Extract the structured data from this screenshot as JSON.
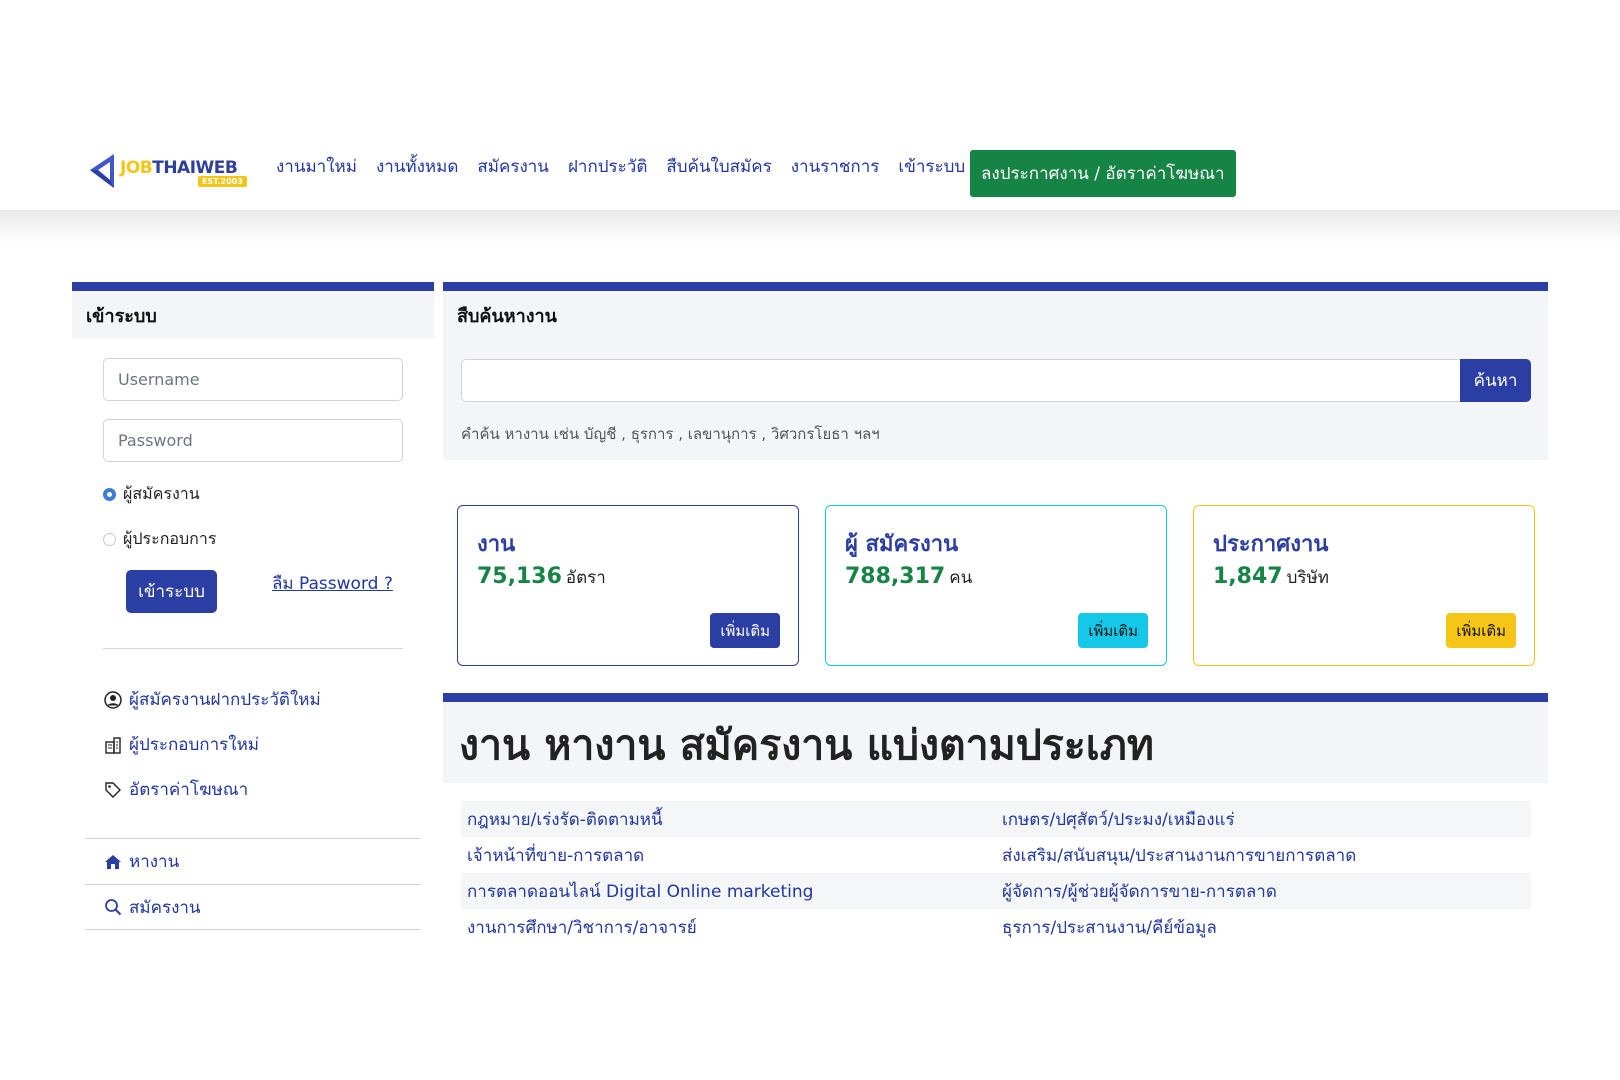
{
  "header": {
    "logo_job": "JOB",
    "logo_rest": "THAIWEB",
    "logo_est": "EST.2003",
    "nav": [
      {
        "label": "งานมาใหม่"
      },
      {
        "label": "งานทั้งหมด"
      },
      {
        "label": "สมัครงาน"
      },
      {
        "label": "ฝากประวัติ"
      },
      {
        "label": "สืบค้นใบสมัคร"
      },
      {
        "label": "งานราชการ"
      },
      {
        "label": "เข้าระบบ"
      }
    ],
    "cta_label": "ลงประกาศงาน / อัตราค่าโฆษณา"
  },
  "login": {
    "title": "เข้าระบบ",
    "username_placeholder": "Username",
    "password_placeholder": "Password",
    "role_options": [
      "ผู้สมัครงาน",
      "ผู้ประกอบการ"
    ],
    "selected_role": "ผู้สมัครงาน",
    "submit_label": "เข้าระบบ",
    "forgot_label": "ลืม Password ?",
    "links": [
      {
        "label": "ผู้สมัครงานฝากประวัติใหม่",
        "icon": "user-circle-icon"
      },
      {
        "label": "ผู้ประกอบการใหม่",
        "icon": "building-icon"
      },
      {
        "label": "อัตราค่าโฆษณา",
        "icon": "tag-icon"
      }
    ],
    "bottom_nav": [
      {
        "label": "หางาน",
        "icon": "home-icon"
      },
      {
        "label": "สมัครงาน",
        "icon": "search-icon"
      }
    ]
  },
  "search": {
    "title": "สืบค้นหางาน",
    "button_label": "ค้นหา",
    "hint": "คำค้น หางาน เช่น บัญชี , ธุรการ , เลขานุการ , วิศวกรโยธา ฯลฯ"
  },
  "stats": [
    {
      "title": "งาน",
      "value": "75,136",
      "unit": "อัตรา",
      "button": "เพิ่มเติม",
      "color": "#2b3ea3"
    },
    {
      "title": "ผู้ สมัครงาน",
      "value": "788,317",
      "unit": "คน",
      "button": "เพิ่มเติม",
      "color": "#16c8e8"
    },
    {
      "title": "ประกาศงาน",
      "value": "1,847",
      "unit": "บริษัท",
      "button": "เพิ่มเติม",
      "color": "#f5c518"
    }
  ],
  "categories": {
    "title": "งาน หางาน สมัครงาน แบ่งตามประเภท",
    "rows": [
      [
        "กฎหมาย/เร่งรัด-ติดตามหนี้",
        "เกษตร/ปศุสัตว์/ประมง/เหมืองแร่"
      ],
      [
        "เจ้าหน้าที่ขาย-การตลาด",
        "ส่งเสริม/สนับสนุน/ประสานงานการขายการตลาด"
      ],
      [
        "การตลาดออนไลน์ Digital Online marketing",
        "ผู้จัดการ/ผู้ช่วยผู้จัดการขาย-การตลาด"
      ],
      [
        "งานการศึกษา/วิชาการ/อาจารย์",
        "ธุรการ/ประสานงาน/คีย์ข้อมูล"
      ]
    ]
  }
}
